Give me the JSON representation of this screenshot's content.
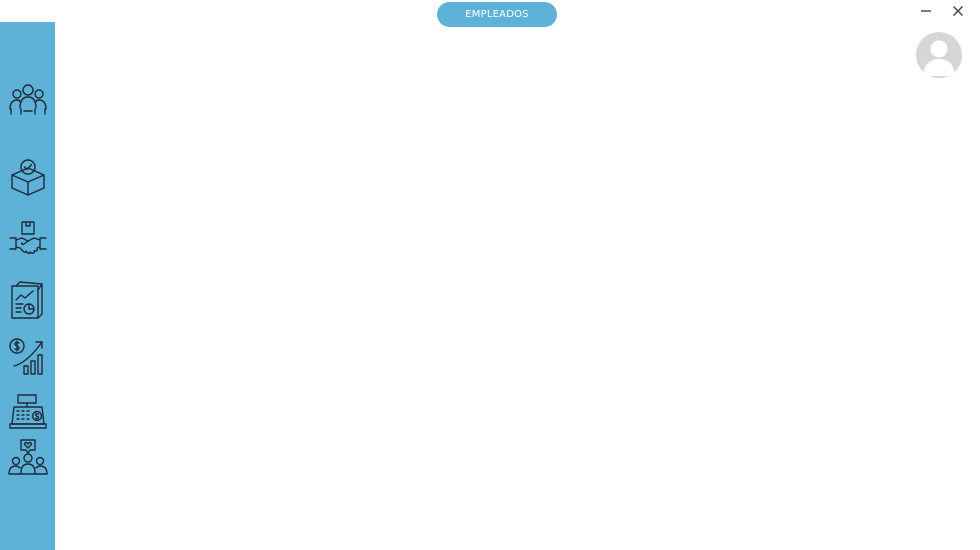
{
  "header": {
    "title": "EMPLEADOS"
  },
  "window_controls": {
    "minimize_icon": "minimize-icon",
    "close_icon": "close-icon"
  },
  "sidebar": {
    "items": [
      {
        "id": "employees",
        "icon": "team-group-icon"
      },
      {
        "id": "products",
        "icon": "box-check-icon"
      },
      {
        "id": "suppliers",
        "icon": "handshake-box-icon"
      },
      {
        "id": "reports",
        "icon": "report-chart-icon"
      },
      {
        "id": "finance",
        "icon": "money-growth-icon"
      },
      {
        "id": "cash-register",
        "icon": "cash-register-icon"
      },
      {
        "id": "customers",
        "icon": "customers-heart-icon"
      }
    ]
  },
  "user": {
    "avatar_icon": "user-avatar-icon"
  },
  "colors": {
    "accent": "#5eb2d8",
    "icon_stroke": "#1e2a38",
    "background": "#ffffff",
    "avatar_bg": "#d6d6d6"
  }
}
